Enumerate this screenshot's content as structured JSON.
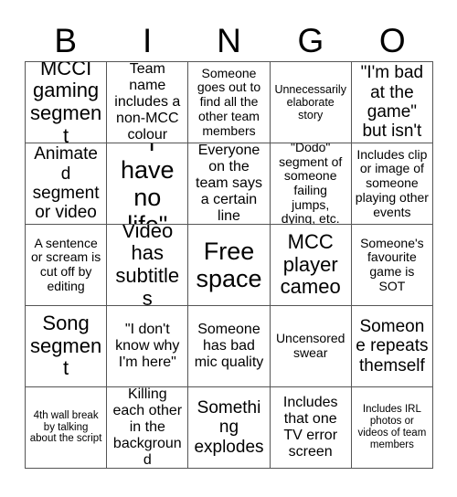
{
  "header": {
    "letters": [
      "B",
      "I",
      "N",
      "G",
      "O"
    ]
  },
  "grid": {
    "rows": 5,
    "columns": 5,
    "border_color": "#555555",
    "background_color": "#ffffff",
    "text_color": "#000000",
    "cells": [
      {
        "text": "MCCI gaming segment",
        "size": "xl"
      },
      {
        "text": "Team name includes a non-MCC colour",
        "size": "md"
      },
      {
        "text": "Someone goes out to find all the other team members",
        "size": "sm"
      },
      {
        "text": "Unnecessarily elaborate story",
        "size": "xs"
      },
      {
        "text": "\"I'm bad at the game\" but isn't",
        "size": "lg"
      },
      {
        "text": "Animated segment or video",
        "size": "lg"
      },
      {
        "text": "\"I have no life\"",
        "size": "xxl"
      },
      {
        "text": "Everyone on the team says a certain line",
        "size": "md"
      },
      {
        "text": "\"Dodo\" segment of someone failing jumps, dying, etc.",
        "size": "sm"
      },
      {
        "text": "Includes clip or image of someone playing other events",
        "size": "sm"
      },
      {
        "text": "A sentence or scream is cut off by editing",
        "size": "sm"
      },
      {
        "text": "Video has subtitles",
        "size": "xl"
      },
      {
        "text": "Free space",
        "size": "xxl"
      },
      {
        "text": "MCC player cameo",
        "size": "xl"
      },
      {
        "text": "Someone's favourite game is SOT",
        "size": "sm"
      },
      {
        "text": "Song segment",
        "size": "xl"
      },
      {
        "text": "\"I don't know why I'm here\"",
        "size": "md"
      },
      {
        "text": "Someone has bad mic quality",
        "size": "md"
      },
      {
        "text": "Uncensored swear",
        "size": "sm"
      },
      {
        "text": "Someone repeats themself",
        "size": "lg"
      },
      {
        "text": "4th wall break by talking about the script",
        "size": "xxs"
      },
      {
        "text": "Killing each other in the background",
        "size": "md"
      },
      {
        "text": "Something explodes",
        "size": "lg"
      },
      {
        "text": "Includes that one TV error screen",
        "size": "md"
      },
      {
        "text": "Includes IRL photos or videos of team members",
        "size": "xxs"
      }
    ]
  }
}
